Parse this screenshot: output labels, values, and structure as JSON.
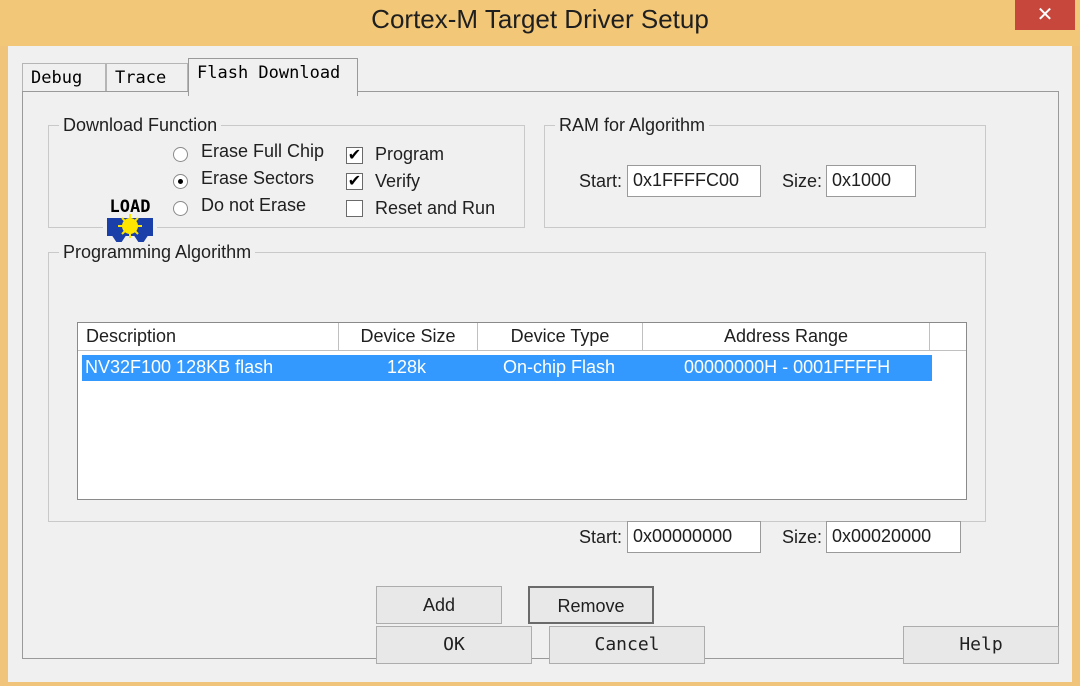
{
  "window": {
    "title": "Cortex-M Target Driver Setup",
    "close_glyph": "✕"
  },
  "tabs": [
    {
      "label": "Debug"
    },
    {
      "label": "Trace"
    },
    {
      "label": "Flash Download",
      "active": true
    }
  ],
  "download_function": {
    "legend": "Download Function",
    "icon_label": "LOAD",
    "icon": "load-icon",
    "radios": [
      {
        "label": "Erase Full Chip",
        "selected": false
      },
      {
        "label": "Erase Sectors",
        "selected": true
      },
      {
        "label": "Do not Erase",
        "selected": false
      }
    ],
    "checks": [
      {
        "label": "Program",
        "checked": true
      },
      {
        "label": "Verify",
        "checked": true
      },
      {
        "label": "Reset and Run",
        "checked": false
      }
    ]
  },
  "ram": {
    "legend": "RAM for Algorithm",
    "start_label": "Start:",
    "start_value": "0x1FFFFC00",
    "size_label": "Size:",
    "size_value": "0x1000"
  },
  "algorithm": {
    "legend": "Programming Algorithm",
    "columns": [
      "Description",
      "Device Size",
      "Device Type",
      "Address Range"
    ],
    "rows": [
      {
        "description": "NV32F100 128KB flash",
        "size": "128k",
        "type": "On-chip Flash",
        "range": "00000000H - 0001FFFFH",
        "selected": true
      }
    ],
    "start_label": "Start:",
    "start_value": "0x00000000",
    "size_label": "Size:",
    "size_value": "0x00020000"
  },
  "buttons": {
    "add": "Add",
    "remove": "Remove",
    "ok": "OK",
    "cancel": "Cancel",
    "help": "Help"
  },
  "colors": {
    "selection": "#3399ff",
    "titlebar": "#f2c778",
    "close": "#c7473c"
  }
}
